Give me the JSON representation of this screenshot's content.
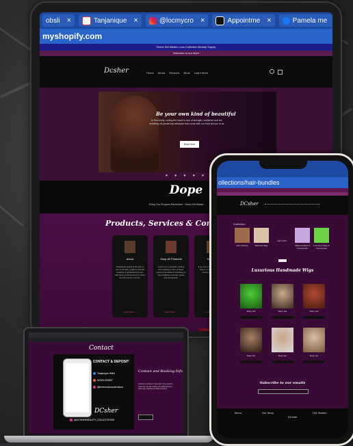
{
  "tablet": {
    "tabs": [
      {
        "label": "obsli",
        "icon": "partial-tab-icon"
      },
      {
        "label": "Tanjanique",
        "icon": "gmail-icon"
      },
      {
        "label": "@locmycro",
        "icon": "instagram-icon"
      },
      {
        "label": "Appointme",
        "icon": "square-icon"
      },
      {
        "label": "Pamela me",
        "icon": "facebook-icon"
      }
    ],
    "tab_close": "×",
    "url": "myshopify.com",
    "announcement": "Divine Kid Master Loos Collection Beauty Supply",
    "welcome": "Welcome to our store",
    "logo": "Dcsher",
    "nav": [
      "Home",
      "About",
      "Services",
      "Book",
      "Learn More"
    ],
    "hero_title": "Be your own kind of beautiful",
    "hero_text": "In this lovely, curling the wave to see of strength, resilience and the breaking off perceiving hairstyles that come with our lives tell you of us",
    "hero_button": "Book Now",
    "band_title": "Dope",
    "marquee": "Doing Our Prospers Remember · Divine Kid Master",
    "section_title": "Products, Services & Contact",
    "cards": [
      {
        "title": "About",
        "body": "Tanjanique's inspiring life story is one of strength, resiliency and the breaking of generational curses that have prevented me from being the best person I can be.",
        "link": "Learn More →"
      },
      {
        "title": "Shop All Products",
        "body": "Lorem sum a products, starting from washing to hair, services, creams and whatever including our wig installation products, grows and accessories.",
        "link": "Learn More →"
      },
      {
        "title": "Services",
        "body": "If you are looking for healthy hair care or create a style you are looking for Tanjanique.",
        "link": "Learn More →"
      }
    ]
  },
  "laptop": {
    "contact_title": "Contact",
    "card_heading": "CONTACT & DEPOSIT",
    "lines": [
      {
        "text": "Tanjanique HMN",
        "color": "#2a8ad4"
      },
      {
        "text": "ARUN-000687",
        "color": "#e06a2a"
      },
      {
        "text": "@kreemsaloncollections",
        "color": "#d43a8a"
      }
    ],
    "card_logo": "DCsher",
    "footer_handle": "@DCSHERBEAUTY_COLLECTIONS",
    "right_title": "Contact and Booking Info",
    "right_body": "Contact us at time or via email. If you need to reach me, we will contact you within the time. Cash app, PayPal and Zelle accepted.",
    "right_button": ""
  },
  "phone": {
    "url": "ollections/hair-bundles",
    "logo": "DCsher",
    "collections_label": "Collection",
    "collections": [
      {
        "label": "Hair Clothing",
        "color": "#9b6b4a"
      },
      {
        "label": "Silkened Wigs",
        "color": "#d8c3a5"
      },
      {
        "label": "Hair Cloth",
        "color": "#3a0a36"
      },
      {
        "label": "Silkened Wigs & Accessories",
        "color": "#c9a7e0"
      },
      {
        "label": "Luxurious Wigs & Accessories",
        "color": "#6dd24a"
      }
    ],
    "heading": "Luxurious Handmade Wigs",
    "wigs": [
      {
        "name": "Wavy Set",
        "color": "#4ecb3a"
      },
      {
        "name": "Wavy Set",
        "color": "#caa98a"
      },
      {
        "name": "Wavy Set",
        "color": "#b24a36"
      },
      {
        "name": "Body Set",
        "color": "#a88066"
      },
      {
        "name": "Body Set",
        "color": "#c8a68a"
      },
      {
        "name": "Body Set",
        "color": "#d9bfa3"
      }
    ],
    "subscribe": "Subscribe to our emails",
    "footer_cols": [
      "Menu",
      "Our Story",
      "DCsher",
      "Get Started"
    ]
  }
}
